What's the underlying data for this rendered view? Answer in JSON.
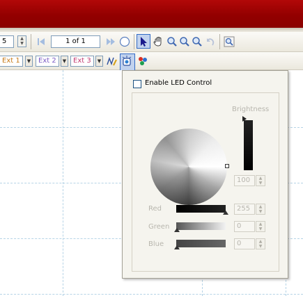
{
  "toolbar": {
    "left_field_value": "5",
    "page_indicator": "1 of 1",
    "ext_buttons": [
      "Ext 1",
      "Ext 2",
      "Ext 3"
    ],
    "icons": {
      "first_page": "first-page-icon",
      "next_page": "next-page-icon",
      "navigate": "compass-icon",
      "select": "arrow-pointer-icon",
      "pan": "hand-icon",
      "zoom_in": "zoom-in-icon",
      "zoom_out": "zoom-out-icon",
      "zoom_area": "zoom-area-icon",
      "undo": "undo-icon",
      "zoom_fit": "zoom-fit-icon",
      "stroke": "stroke-tool-icon",
      "led": "led-control-icon",
      "palette": "palette-icon"
    }
  },
  "led_panel": {
    "enable_label": "Enable LED Control",
    "enabled": false,
    "brightness_label": "Brightness",
    "brightness_value": "100",
    "brightness_level": 1.0,
    "red_label": "Red",
    "red_value": "255",
    "green_label": "Green",
    "green_value": "0",
    "blue_label": "Blue",
    "blue_value": "0"
  },
  "colors": {
    "title_bar": "#a00000",
    "selection": "#c1d2ee",
    "grid": "#b5d3e6"
  }
}
